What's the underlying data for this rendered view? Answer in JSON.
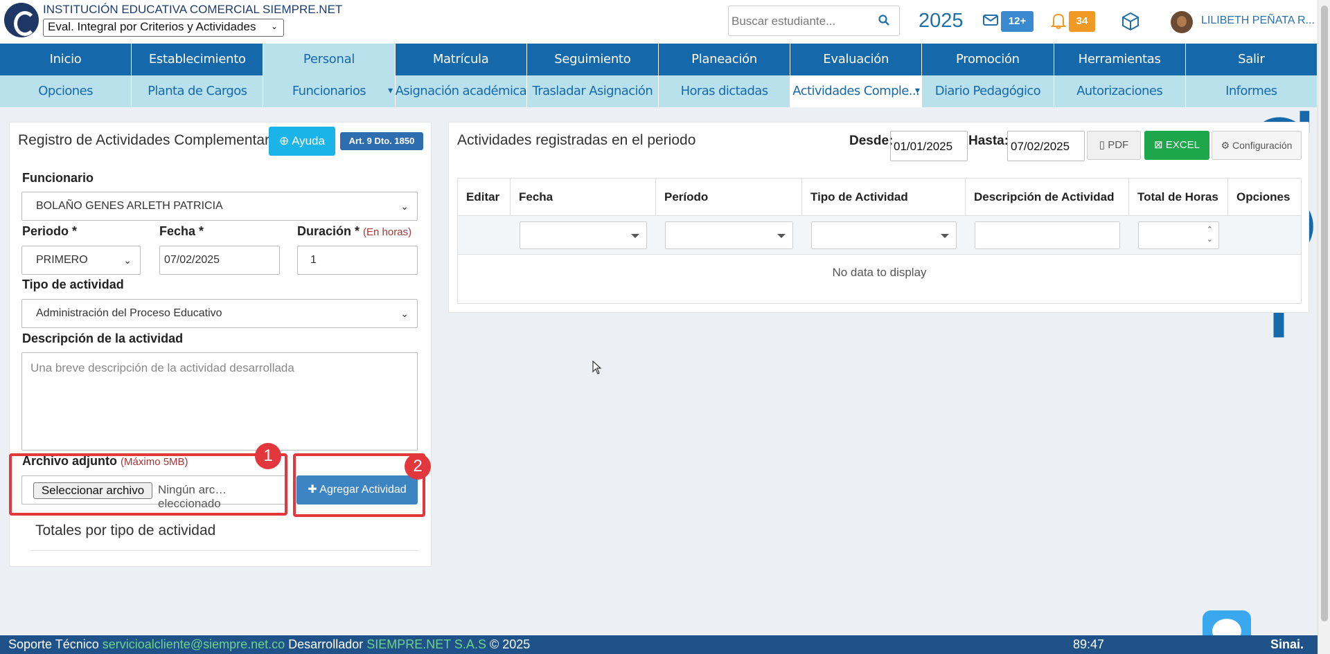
{
  "header": {
    "institution": "INSTITUCIÓN EDUCATIVA COMERCIAL SIEMPRE.NET",
    "eval_select": "Eval. Integral por Criterios y Actividades",
    "search_placeholder": "Buscar estudiante...",
    "year": "2025",
    "mail_badge": "12+",
    "bell_badge": "34",
    "user": "LILIBETH PEÑATA R..."
  },
  "nav_main": [
    "Inicio",
    "Establecimiento",
    "Personal",
    "Matrícula",
    "Seguimiento",
    "Planeación",
    "Evaluación",
    "Promoción",
    "Herramientas",
    "Salir"
  ],
  "nav_sub": [
    "Opciones",
    "Planta de Cargos",
    "Funcionarios",
    "Asignación académica",
    "Trasladar Asignación",
    "Horas dictadas",
    "Actividades Comple...",
    "Diario Pedagógico",
    "Autorizaciones",
    "Informes"
  ],
  "form": {
    "title": "Registro de Actividades Complementarias",
    "ayuda": "Ayuda",
    "art": "Art. 9 Dto. 1850",
    "funcionario_label": "Funcionario",
    "funcionario_value": "BOLAÑO GENES ARLETH PATRICIA",
    "periodo_label": "Periodo *",
    "periodo_value": "PRIMERO",
    "fecha_label": "Fecha *",
    "fecha_value": "07/02/2025",
    "duracion_label": "Duración *",
    "duracion_hint": "(En horas)",
    "duracion_value": "1",
    "tipo_label": "Tipo de actividad",
    "tipo_value": "Administración del Proceso Educativo",
    "desc_label": "Descripción de la actividad",
    "desc_placeholder": "Una breve descripción de la actividad desarrollada",
    "archivo_label": "Archivo adjunto",
    "archivo_hint": "(Máximo 5MB)",
    "file_button": "Seleccionar archivo",
    "file_text": "Ningún arc…eleccionado",
    "agregar": "Agregar Actividad",
    "totales": "Totales por tipo de actividad",
    "badge1": "1",
    "badge2": "2"
  },
  "list": {
    "title": "Actividades registradas en el periodo",
    "desde_label": "Desde:",
    "desde_value": "01/01/2025",
    "hasta_label": "Hasta:",
    "hasta_value": "07/02/2025",
    "pdf": "PDF",
    "excel": "EXCEL",
    "config": "Configuración",
    "columns": [
      "Editar",
      "Fecha",
      "Período",
      "Tipo de Actividad",
      "Descripción de Actividad",
      "Total de Horas",
      "Opciones"
    ],
    "empty": "No data to display"
  },
  "footer": {
    "soporte": "Soporte Técnico",
    "email": "servicioalcliente@siempre.net.co",
    "dev": "Desarrollador",
    "company": "SIEMPRE.NET S.A.S",
    "copy": "© 2025",
    "timer": "89:47",
    "brand": "Sinai."
  },
  "colors": {
    "nav": "#1569ab",
    "nav_sub": "#b9e1ec",
    "highlight": "#e2373c",
    "excel": "#1da64a"
  }
}
